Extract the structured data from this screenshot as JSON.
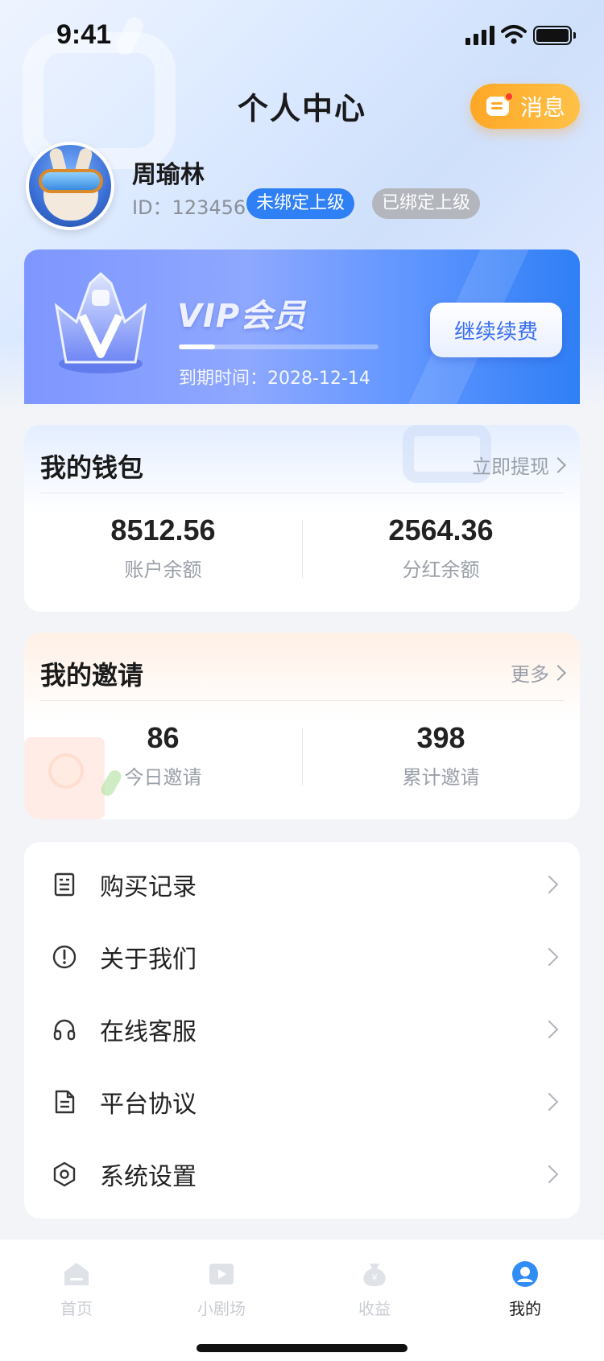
{
  "status_bar": {
    "time": "9:41"
  },
  "header": {
    "title": "个人中心",
    "message_label": "消息"
  },
  "profile": {
    "name": "周瑜林",
    "id_text": "ID：123456",
    "tag_unbound": "未绑定上级",
    "tag_bound": "已绑定上级"
  },
  "vip": {
    "title": "VIP会员",
    "expire_text": "到期时间：2028-12-14",
    "progress": 0.18,
    "renew_label": "继续续费"
  },
  "wallet": {
    "title": "我的钱包",
    "action": "立即提现",
    "stats": [
      {
        "value": "8512.56",
        "label": "账户余额"
      },
      {
        "value": "2564.36",
        "label": "分红余额"
      }
    ]
  },
  "invite": {
    "title": "我的邀请",
    "action": "更多",
    "stats": [
      {
        "value": "86",
        "label": "今日邀请"
      },
      {
        "value": "398",
        "label": "累计邀请"
      }
    ]
  },
  "menu": {
    "items": [
      {
        "label": "购买记录",
        "icon": "receipt-icon"
      },
      {
        "label": "关于我们",
        "icon": "info-circle-icon"
      },
      {
        "label": "在线客服",
        "icon": "headset-icon"
      },
      {
        "label": "平台协议",
        "icon": "document-icon"
      },
      {
        "label": "系统设置",
        "icon": "settings-hexagon-icon"
      }
    ]
  },
  "tabs": [
    {
      "label": "首页",
      "icon": "home-icon"
    },
    {
      "label": "小剧场",
      "icon": "theater-icon"
    },
    {
      "label": "收益",
      "icon": "money-bag-icon"
    },
    {
      "label": "我的",
      "icon": "user-icon",
      "active": true
    }
  ],
  "colors": {
    "accent": "#2f7ff5",
    "message_button": "#ffa726",
    "unbound_tag": "#2f7ff5",
    "bound_tag": "#b3b6bd"
  }
}
